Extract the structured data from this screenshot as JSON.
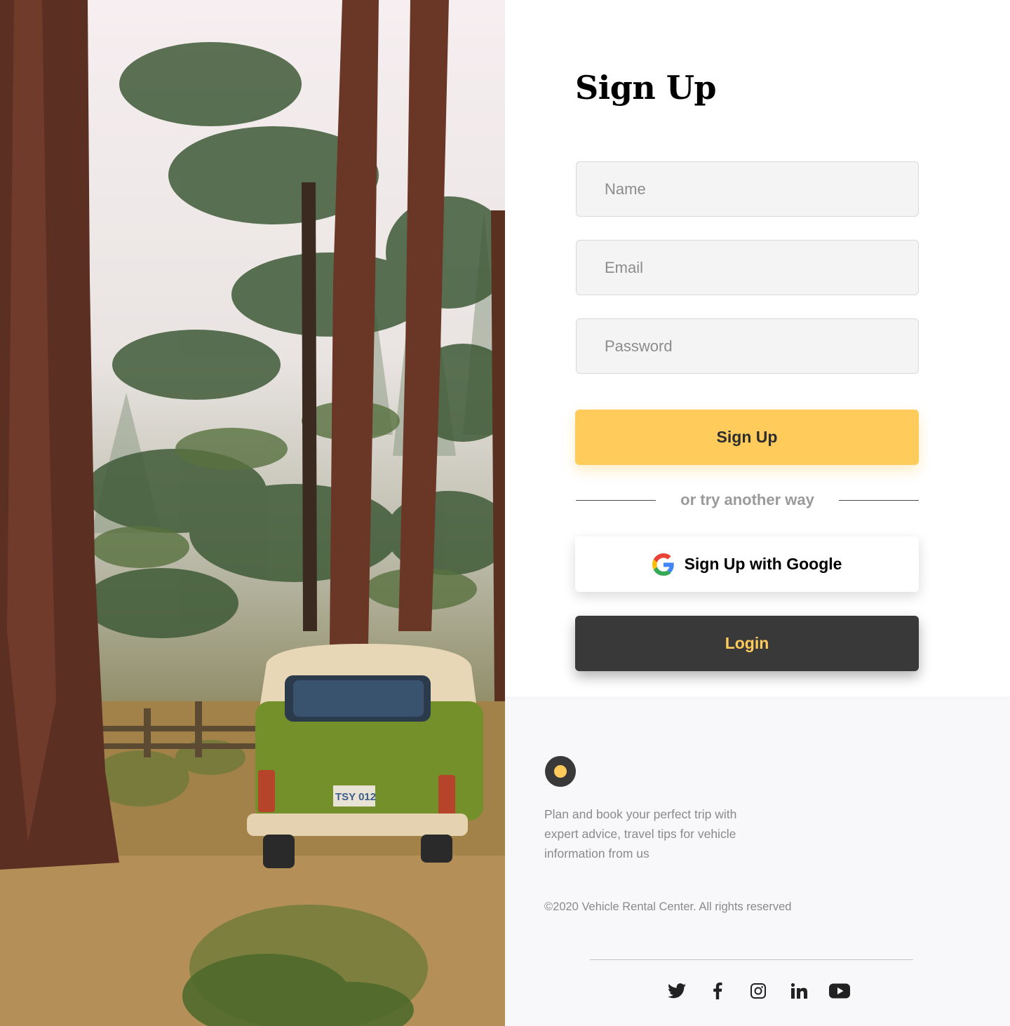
{
  "form": {
    "title": "Sign Up",
    "name_placeholder": "Name",
    "email_placeholder": "Email",
    "password_placeholder": "Password",
    "signup_label": "Sign Up",
    "divider_text": "or try another way",
    "google_label": "Sign Up with Google",
    "login_label": "Login"
  },
  "footer": {
    "tagline": "Plan and book your perfect trip with expert advice, travel tips for vehicle information from us",
    "copyright": "©2020 Vehicle Rental Center. All rights reserved",
    "social_icons": [
      "twitter-icon",
      "facebook-icon",
      "instagram-icon",
      "linkedin-icon",
      "youtube-icon"
    ]
  },
  "photo": {
    "plate": "TSY 012"
  },
  "colors": {
    "accent": "#ffcb5b",
    "dark": "#393939",
    "field_bg": "#f4f4f4",
    "footer_bg": "#f8f8fa"
  }
}
